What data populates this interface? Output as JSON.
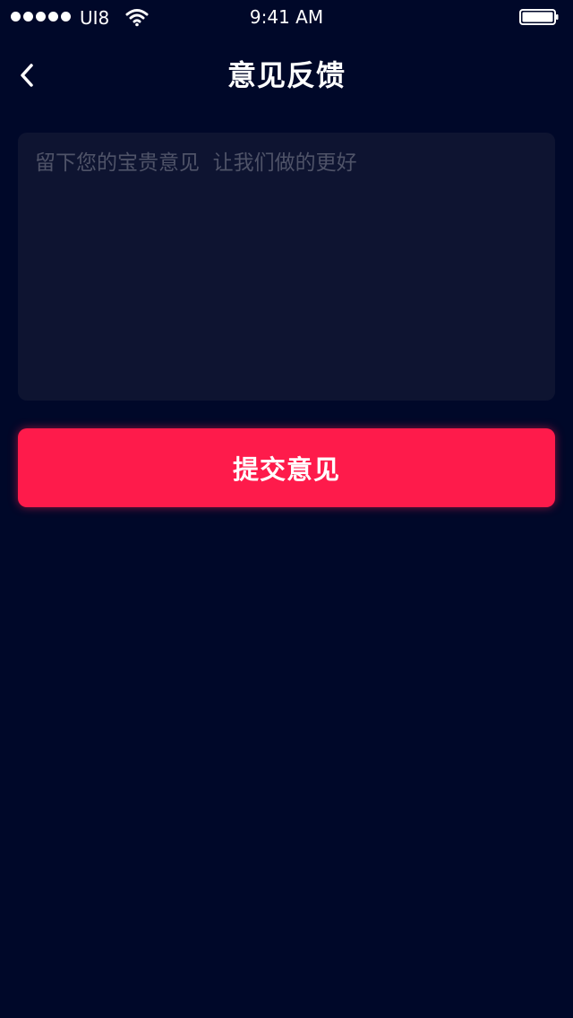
{
  "status_bar": {
    "carrier": "UI8",
    "time": "9:41 AM",
    "signal_icon": "signal-dots-icon",
    "wifi_icon": "wifi-icon",
    "battery_icon": "battery-icon"
  },
  "nav": {
    "title": "意见反馈",
    "back_icon": "chevron-left-icon"
  },
  "feedback": {
    "placeholder": "留下您的宝贵意见  让我们做的更好",
    "value": ""
  },
  "submit": {
    "label": "提交意见"
  },
  "colors": {
    "background": "#000829",
    "input_background": "#0e1431",
    "placeholder": "#4f5368",
    "accent": "#fe1b4b",
    "text": "#ffffff"
  }
}
